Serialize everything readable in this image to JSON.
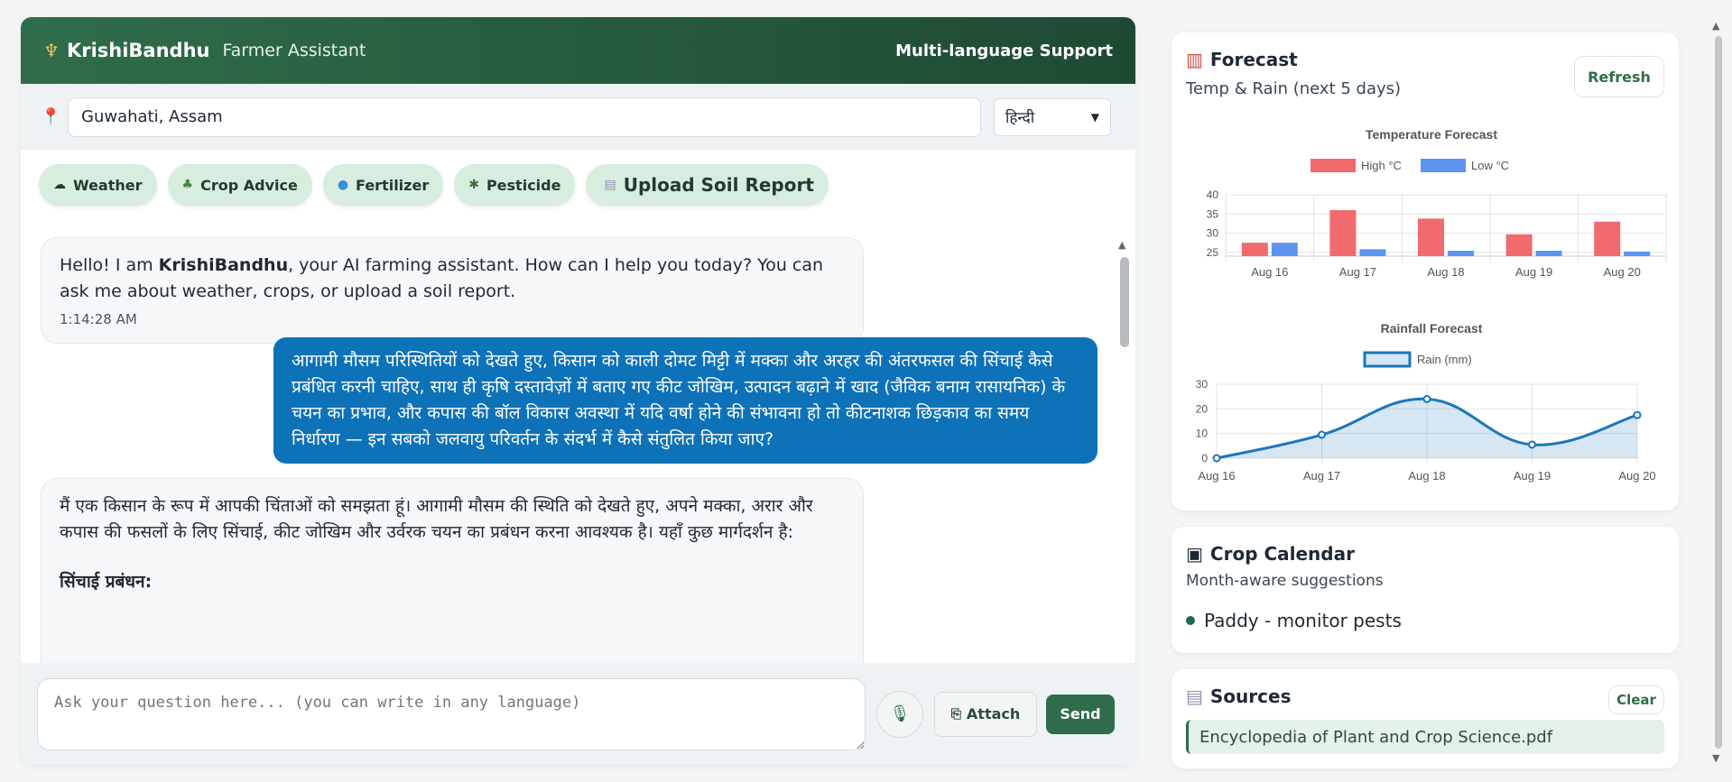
{
  "header": {
    "brand": "KrishiBandhu",
    "subtitle": "Farmer Assistant",
    "right_label": "Multi-language Support"
  },
  "location": {
    "value": "Guwahati, Assam"
  },
  "language": {
    "selected": "हिन्दी"
  },
  "quick_actions": [
    {
      "label": "Weather",
      "icon": "cloud-icon"
    },
    {
      "label": "Crop Advice",
      "icon": "seedling-icon"
    },
    {
      "label": "Fertilizer",
      "icon": "droplet-icon"
    },
    {
      "label": "Pesticide",
      "icon": "bug-icon"
    },
    {
      "label": "Upload Soil Report",
      "icon": "document-icon"
    }
  ],
  "messages": {
    "welcome_before": "Hello! I am ",
    "welcome_brand": "KrishiBandhu",
    "welcome_after": ", your AI farming assistant. How can I help you today? You can ask me about weather, crops, or upload a soil report.",
    "welcome_time": "1:14:28 AM",
    "user_text": "आगामी मौसम परिस्थितियों को देखते हुए, किसान को काली दोमट मिट्टी में मक्का और अरहर की अंतरफसल की सिंचाई कैसे प्रबंधित करनी चाहिए, साथ ही कृषि दस्तावेज़ों में बताए गए कीट जोखिम, उत्पादन बढ़ाने में खाद (जैविक बनाम रासायनिक) के चयन का प्रभाव, और कपास की बॉल विकास अवस्था में यदि वर्षा होने की संभावना हो तो कीटनाशक छिड़काव का समय निर्धारण — इन सबको जलवायु परिवर्तन के संदर्भ में कैसे संतुलित किया जाए?",
    "bot_reply": "मैं एक किसान के रूप में आपकी चिंताओं को समझता हूं। आगामी मौसम की स्थिति को देखते हुए, अपने मक्का, अरार और कपास की फसलों के लिए सिंचाई, कीट जोखिम और उर्वरक चयन का प्रबंधन करना आवश्यक है। यहाँ कुछ मार्गदर्शन है:",
    "bot_heading": "सिंचाई प्रबंधन:"
  },
  "composer": {
    "placeholder": "Ask your question here... (you can write in any language)",
    "attach_label": "Attach",
    "send_label": "Send"
  },
  "forecast": {
    "title": "Forecast",
    "subtitle": "Temp & Rain (next 5 days)",
    "refresh_label": "Refresh"
  },
  "crop_calendar": {
    "title": "Crop Calendar",
    "subtitle": "Month-aware suggestions",
    "items": [
      "Paddy - monitor pests"
    ]
  },
  "sources": {
    "title": "Sources",
    "clear_label": "Clear",
    "items": [
      "Encyclopedia of Plant and Crop Science.pdf"
    ]
  },
  "colors": {
    "header_start": "#2f6d4a",
    "header_end": "#1e4a33",
    "user_bubble": "#0d72b8",
    "high_bar": "#f06a6e",
    "low_bar": "#5b95f0",
    "rain_line": "#1c77b8"
  },
  "chart_data": [
    {
      "type": "bar",
      "title": "Temperature Forecast",
      "categories": [
        "Aug 16",
        "Aug 17",
        "Aug 18",
        "Aug 19",
        "Aug 20"
      ],
      "series": [
        {
          "name": "High °C",
          "values": [
            27.5,
            36,
            33.8,
            29.7,
            33
          ]
        },
        {
          "name": "Low °C",
          "values": [
            27.5,
            25.8,
            25.4,
            25.4,
            25.2
          ]
        }
      ],
      "ylim": [
        24,
        40
      ],
      "yticks": [
        25,
        30,
        35,
        40
      ],
      "grid": true,
      "legend": "top"
    },
    {
      "type": "area",
      "title": "Rainfall Forecast",
      "categories": [
        "Aug 16",
        "Aug 17",
        "Aug 18",
        "Aug 19",
        "Aug 20"
      ],
      "series": [
        {
          "name": "Rain (mm)",
          "values": [
            0,
            9.5,
            24,
            5.5,
            17.5
          ]
        }
      ],
      "ylim": [
        0,
        30
      ],
      "yticks": [
        0,
        10,
        20,
        30
      ],
      "grid": true,
      "legend": "top"
    }
  ]
}
